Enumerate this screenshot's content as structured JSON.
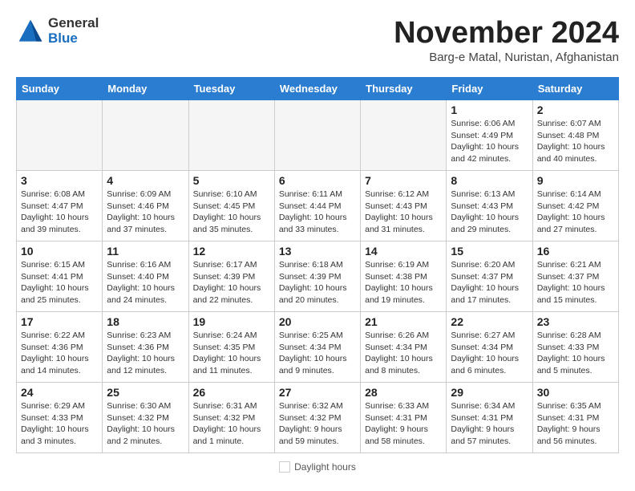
{
  "logo": {
    "general": "General",
    "blue": "Blue"
  },
  "title": "November 2024",
  "location": "Barg-e Matal, Nuristan, Afghanistan",
  "legend": {
    "daylight": "Daylight hours"
  },
  "days_header": [
    "Sunday",
    "Monday",
    "Tuesday",
    "Wednesday",
    "Thursday",
    "Friday",
    "Saturday"
  ],
  "weeks": [
    [
      {
        "num": "",
        "info": ""
      },
      {
        "num": "",
        "info": ""
      },
      {
        "num": "",
        "info": ""
      },
      {
        "num": "",
        "info": ""
      },
      {
        "num": "",
        "info": ""
      },
      {
        "num": "1",
        "info": "Sunrise: 6:06 AM\nSunset: 4:49 PM\nDaylight: 10 hours and 42 minutes."
      },
      {
        "num": "2",
        "info": "Sunrise: 6:07 AM\nSunset: 4:48 PM\nDaylight: 10 hours and 40 minutes."
      }
    ],
    [
      {
        "num": "3",
        "info": "Sunrise: 6:08 AM\nSunset: 4:47 PM\nDaylight: 10 hours and 39 minutes."
      },
      {
        "num": "4",
        "info": "Sunrise: 6:09 AM\nSunset: 4:46 PM\nDaylight: 10 hours and 37 minutes."
      },
      {
        "num": "5",
        "info": "Sunrise: 6:10 AM\nSunset: 4:45 PM\nDaylight: 10 hours and 35 minutes."
      },
      {
        "num": "6",
        "info": "Sunrise: 6:11 AM\nSunset: 4:44 PM\nDaylight: 10 hours and 33 minutes."
      },
      {
        "num": "7",
        "info": "Sunrise: 6:12 AM\nSunset: 4:43 PM\nDaylight: 10 hours and 31 minutes."
      },
      {
        "num": "8",
        "info": "Sunrise: 6:13 AM\nSunset: 4:43 PM\nDaylight: 10 hours and 29 minutes."
      },
      {
        "num": "9",
        "info": "Sunrise: 6:14 AM\nSunset: 4:42 PM\nDaylight: 10 hours and 27 minutes."
      }
    ],
    [
      {
        "num": "10",
        "info": "Sunrise: 6:15 AM\nSunset: 4:41 PM\nDaylight: 10 hours and 25 minutes."
      },
      {
        "num": "11",
        "info": "Sunrise: 6:16 AM\nSunset: 4:40 PM\nDaylight: 10 hours and 24 minutes."
      },
      {
        "num": "12",
        "info": "Sunrise: 6:17 AM\nSunset: 4:39 PM\nDaylight: 10 hours and 22 minutes."
      },
      {
        "num": "13",
        "info": "Sunrise: 6:18 AM\nSunset: 4:39 PM\nDaylight: 10 hours and 20 minutes."
      },
      {
        "num": "14",
        "info": "Sunrise: 6:19 AM\nSunset: 4:38 PM\nDaylight: 10 hours and 19 minutes."
      },
      {
        "num": "15",
        "info": "Sunrise: 6:20 AM\nSunset: 4:37 PM\nDaylight: 10 hours and 17 minutes."
      },
      {
        "num": "16",
        "info": "Sunrise: 6:21 AM\nSunset: 4:37 PM\nDaylight: 10 hours and 15 minutes."
      }
    ],
    [
      {
        "num": "17",
        "info": "Sunrise: 6:22 AM\nSunset: 4:36 PM\nDaylight: 10 hours and 14 minutes."
      },
      {
        "num": "18",
        "info": "Sunrise: 6:23 AM\nSunset: 4:36 PM\nDaylight: 10 hours and 12 minutes."
      },
      {
        "num": "19",
        "info": "Sunrise: 6:24 AM\nSunset: 4:35 PM\nDaylight: 10 hours and 11 minutes."
      },
      {
        "num": "20",
        "info": "Sunrise: 6:25 AM\nSunset: 4:34 PM\nDaylight: 10 hours and 9 minutes."
      },
      {
        "num": "21",
        "info": "Sunrise: 6:26 AM\nSunset: 4:34 PM\nDaylight: 10 hours and 8 minutes."
      },
      {
        "num": "22",
        "info": "Sunrise: 6:27 AM\nSunset: 4:34 PM\nDaylight: 10 hours and 6 minutes."
      },
      {
        "num": "23",
        "info": "Sunrise: 6:28 AM\nSunset: 4:33 PM\nDaylight: 10 hours and 5 minutes."
      }
    ],
    [
      {
        "num": "24",
        "info": "Sunrise: 6:29 AM\nSunset: 4:33 PM\nDaylight: 10 hours and 3 minutes."
      },
      {
        "num": "25",
        "info": "Sunrise: 6:30 AM\nSunset: 4:32 PM\nDaylight: 10 hours and 2 minutes."
      },
      {
        "num": "26",
        "info": "Sunrise: 6:31 AM\nSunset: 4:32 PM\nDaylight: 10 hours and 1 minute."
      },
      {
        "num": "27",
        "info": "Sunrise: 6:32 AM\nSunset: 4:32 PM\nDaylight: 9 hours and 59 minutes."
      },
      {
        "num": "28",
        "info": "Sunrise: 6:33 AM\nSunset: 4:31 PM\nDaylight: 9 hours and 58 minutes."
      },
      {
        "num": "29",
        "info": "Sunrise: 6:34 AM\nSunset: 4:31 PM\nDaylight: 9 hours and 57 minutes."
      },
      {
        "num": "30",
        "info": "Sunrise: 6:35 AM\nSunset: 4:31 PM\nDaylight: 9 hours and 56 minutes."
      }
    ]
  ]
}
